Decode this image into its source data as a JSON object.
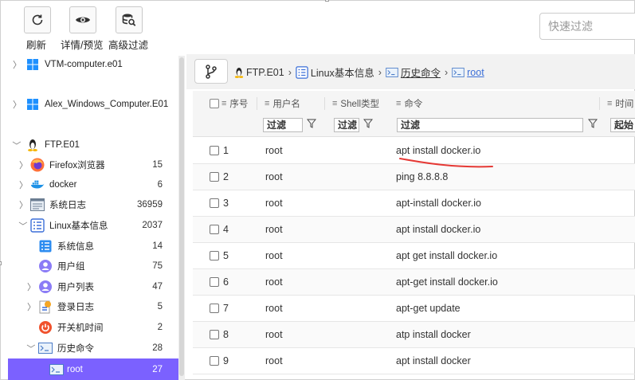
{
  "toolbar": {
    "refresh_label": "刷新",
    "details_label": "详情/预览",
    "advanced_filter_label": "高级过滤",
    "quick_filter_placeholder": "快速过滤"
  },
  "tree": {
    "computers": [
      {
        "label": "VTM-computer.e01",
        "icon": "windows-icon"
      },
      {
        "label": "Alex_Windows_Computer.E01",
        "icon": "windows-icon"
      },
      {
        "label": "FTP.E01",
        "icon": "linux-tux-icon"
      }
    ],
    "ftp_children": [
      {
        "label": "Firefox浏览器",
        "count": "15",
        "icon": "firefox-icon"
      },
      {
        "label": "docker",
        "count": "6",
        "icon": "docker-icon"
      },
      {
        "label": "系统日志",
        "count": "36959",
        "icon": "system-log-icon"
      },
      {
        "label": "Linux基本信息",
        "count": "2037",
        "icon": "list-icon"
      }
    ],
    "linux_children": [
      {
        "label": "系统信息",
        "count": "14",
        "icon": "system-info-icon"
      },
      {
        "label": "用户组",
        "count": "75",
        "icon": "user-group-icon"
      },
      {
        "label": "用户列表",
        "count": "47",
        "icon": "user-list-icon"
      },
      {
        "label": "登录日志",
        "count": "5",
        "icon": "login-log-icon"
      },
      {
        "label": "开关机时间",
        "count": "2",
        "icon": "power-icon"
      },
      {
        "label": "历史命令",
        "count": "28",
        "icon": "terminal-icon"
      }
    ],
    "selected": {
      "label": "root",
      "count": "27",
      "icon": "terminal-icon"
    }
  },
  "breadcrumb": {
    "items": [
      "FTP.E01",
      "Linux基本信息",
      "历史命令",
      "root"
    ],
    "separator": "›"
  },
  "table": {
    "columns": {
      "seq": "序号",
      "username": "用户名",
      "shell_type": "Shell类型",
      "command": "命令",
      "time": "时间"
    },
    "filter_text": "过滤",
    "time_filter_text": "起始",
    "rows": [
      {
        "seq": "1",
        "user": "root",
        "cmd": "apt install docker.io"
      },
      {
        "seq": "2",
        "user": "root",
        "cmd": "ping 8.8.8.8"
      },
      {
        "seq": "3",
        "user": "root",
        "cmd": "apt-install docker.io"
      },
      {
        "seq": "4",
        "user": "root",
        "cmd": "apt install docker.io"
      },
      {
        "seq": "5",
        "user": "root",
        "cmd": "apt get install docker.io"
      },
      {
        "seq": "6",
        "user": "root",
        "cmd": "apt-get install docker.io"
      },
      {
        "seq": "7",
        "user": "root",
        "cmd": "apt-get update"
      },
      {
        "seq": "8",
        "user": "root",
        "cmd": "atp install docker"
      },
      {
        "seq": "9",
        "user": "root",
        "cmd": "apt install docker"
      }
    ]
  },
  "colors": {
    "selection": "#7b61ff",
    "link": "#3b6fd8",
    "annotation": "#e53935"
  }
}
